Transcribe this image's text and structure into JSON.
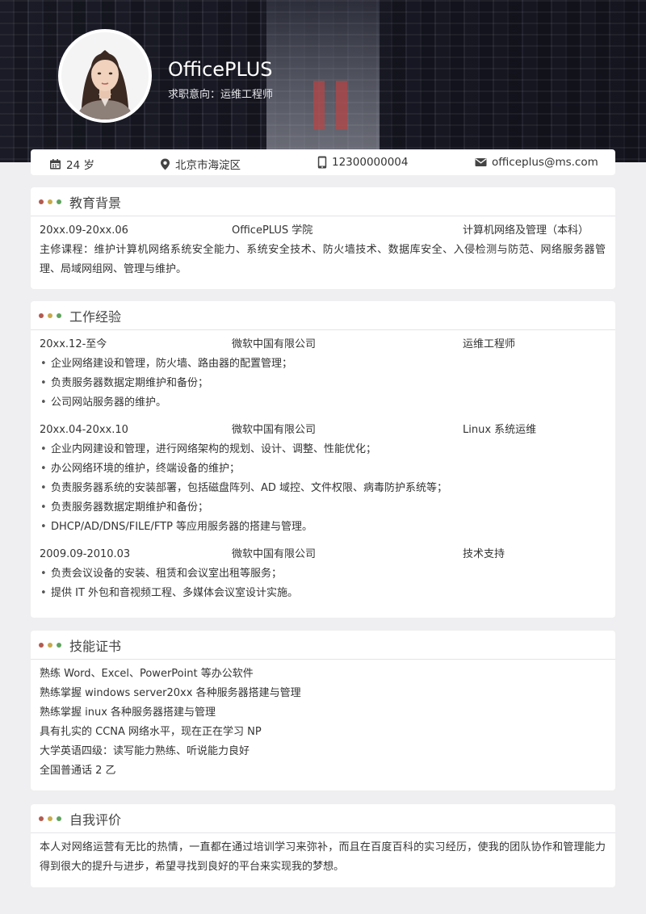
{
  "colors": {
    "dot_red": "#b35a4f",
    "dot_yellow": "#c9a94c",
    "dot_green": "#5fa35e",
    "header_bg": "#1c1d28"
  },
  "header": {
    "name": "OfficePLUS",
    "intent": "求职意向：运维工程师"
  },
  "info": {
    "age": "24 岁",
    "location": "北京市海淀区",
    "phone": "12300000004",
    "email": "officeplus@ms.com",
    "icons": [
      "calendar-icon",
      "location-pin-icon",
      "phone-icon",
      "mail-icon"
    ]
  },
  "education": {
    "title": "教育背景",
    "period": "20xx.09-20xx.06",
    "school": "OfficePLUS 学院",
    "major": "计算机网络及管理（本科）",
    "courses": "主修课程：维护计算机网络系统安全能力、系统安全技术、防火墙技术、数据库安全、入侵检测与防范、网络服务器管理、局域网组网、管理与维护。"
  },
  "work": {
    "title": "工作经验",
    "jobs": [
      {
        "period": "20xx.12-至今",
        "company": "微软中国有限公司",
        "role": "运维工程师",
        "items": [
          "企业网络建设和管理，防火墙、路由器的配置管理；",
          "负责服务器数据定期维护和备份；",
          "公司网站服务器的维护。"
        ]
      },
      {
        "period": "20xx.04-20xx.10",
        "company": "微软中国有限公司",
        "role": "Linux 系统运维",
        "items": [
          "企业内网建设和管理，进行网络架构的规划、设计、调整、性能优化；",
          "办公网络环境的维护，终端设备的维护；",
          "负责服务器系统的安装部署，包括磁盘阵列、AD 域控、文件权限、病毒防护系统等；",
          "负责服务器数据定期维护和备份；",
          "DHCP/AD/DNS/FILE/FTP 等应用服务器的搭建与管理。"
        ]
      },
      {
        "period": "2009.09-2010.03",
        "company": "微软中国有限公司",
        "role": "技术支持",
        "items": [
          "负责会议设备的安装、租赁和会议室出租等服务；",
          "提供 IT 外包和音视频工程、多媒体会议室设计实施。"
        ]
      }
    ]
  },
  "skills": {
    "title": "技能证书",
    "lines": [
      "熟练 Word、Excel、PowerPoint 等办公软件",
      "熟练掌握 windows server20xx 各种服务器搭建与管理",
      "熟练掌握 inux  各种服务器搭建与管理",
      "具有扎实的 CCNA  网络水平，现在正在学习 NP",
      "大学英语四级：读写能力熟练、听说能力良好",
      "全国普通话 2 乙"
    ]
  },
  "self": {
    "title": "自我评价",
    "text": "本人对网络运营有无比的热情，一直都在通过培训学习来弥补，而且在百度百科的实习经历，使我的团队协作和管理能力得到很大的提升与进步，希望寻找到良好的平台来实现我的梦想。"
  }
}
